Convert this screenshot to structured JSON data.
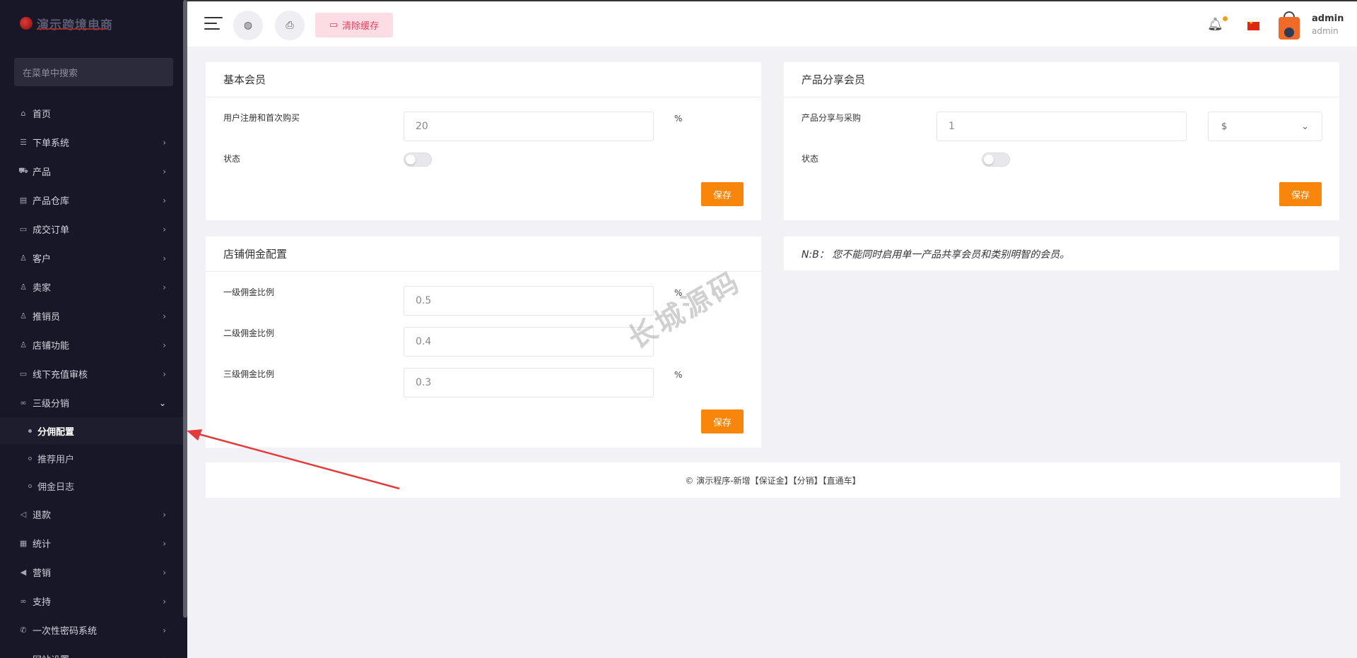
{
  "brand": {
    "name": "演示跨境电商"
  },
  "sidebar": {
    "search_placeholder": "在菜单中搜索",
    "items": [
      {
        "label": "首页",
        "icon": "home-icon",
        "glyph": "⌂",
        "has_arrow": false
      },
      {
        "label": "下单系统",
        "icon": "list-icon",
        "glyph": "☰",
        "has_arrow": true
      },
      {
        "label": "产品",
        "icon": "cart-icon",
        "glyph": "⛟",
        "has_arrow": true
      },
      {
        "label": "产品仓库",
        "icon": "warehouse-icon",
        "glyph": "▤",
        "has_arrow": true
      },
      {
        "label": "成交订单",
        "icon": "order-icon",
        "glyph": "▭",
        "has_arrow": true
      },
      {
        "label": "客户",
        "icon": "users-icon",
        "glyph": "♙",
        "has_arrow": true
      },
      {
        "label": "卖家",
        "icon": "seller-icon",
        "glyph": "♙",
        "has_arrow": true
      },
      {
        "label": "推销员",
        "icon": "salesman-icon",
        "glyph": "♙",
        "has_arrow": true
      },
      {
        "label": "店铺功能",
        "icon": "store-icon",
        "glyph": "♙",
        "has_arrow": true
      },
      {
        "label": "线下充值审核",
        "icon": "recharge-icon",
        "glyph": "▭",
        "has_arrow": true
      },
      {
        "label": "三级分销",
        "icon": "link-icon",
        "glyph": "∞",
        "has_arrow": true,
        "open": true,
        "children": [
          {
            "label": "分佣配置",
            "active": true
          },
          {
            "label": "推荐用户",
            "active": false
          },
          {
            "label": "佣金日志",
            "active": false
          }
        ]
      },
      {
        "label": "退款",
        "icon": "refund-icon",
        "glyph": "◁",
        "has_arrow": true
      },
      {
        "label": "统计",
        "icon": "report-icon",
        "glyph": "▦",
        "has_arrow": true
      },
      {
        "label": "营销",
        "icon": "megaphone-icon",
        "glyph": "◀",
        "has_arrow": true
      },
      {
        "label": "支持",
        "icon": "support-icon",
        "glyph": "∞",
        "has_arrow": true
      },
      {
        "label": "一次性密码系统",
        "icon": "phone-icon",
        "glyph": "✆",
        "has_arrow": true
      },
      {
        "label": "网站设置",
        "icon": "settings-icon",
        "glyph": "▭",
        "has_arrow": true
      }
    ]
  },
  "topbar": {
    "clear_cache_label": "清除缓存",
    "user_name": "admin",
    "user_role": "admin"
  },
  "basic_member": {
    "title": "基本会员",
    "field_label": "用户注册和首次购买",
    "field_value": "20",
    "unit": "%",
    "status_label": "状态",
    "save_label": "保存"
  },
  "product_share": {
    "title": "产品分享会员",
    "field_label": "产品分享与采购",
    "field_value": "1",
    "currency": "$",
    "status_label": "状态",
    "save_label": "保存"
  },
  "store_commission": {
    "title": "店铺佣金配置",
    "fields": [
      {
        "label": "一级佣金比例",
        "value": "0.5",
        "unit": "%"
      },
      {
        "label": "二级佣金比例",
        "value": "0.4",
        "unit": ""
      },
      {
        "label": "三级佣金比例",
        "value": "0.3",
        "unit": "%"
      }
    ],
    "save_label": "保存"
  },
  "note": {
    "text": "N:B： 您不能同时启用单一产品共享会员和类别明智的会员。"
  },
  "footer": {
    "text": "© 演示程序-新增【保证金】【分销】【直通车】"
  },
  "watermark": {
    "text": "长城源码"
  },
  "colors": {
    "sidebar_bg": "#171727",
    "accent_orange": "#f7860a",
    "clear_cache_bg": "#fbdde3",
    "arrow_red": "#e33b3b"
  }
}
